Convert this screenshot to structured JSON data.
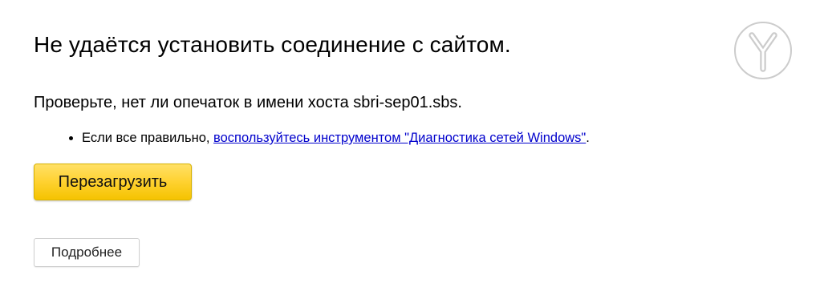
{
  "error": {
    "title": "Не удаётся установить соединение с сайтом.",
    "check_host_text": "Проверьте, нет ли опечаток в имени хоста sbri-sep01.sbs.",
    "hint": {
      "prefix": "Если все правильно, ",
      "link_text": "воспользуйтесь инструментом \"Диагностика сетей Windows\"",
      "suffix": "."
    }
  },
  "buttons": {
    "reload_label": "Перезагрузить",
    "details_label": "Подробнее"
  },
  "icons": {
    "logo": "yandex-browser-logo-icon"
  },
  "colors": {
    "reload_button": "#ffd335",
    "link": "#0000cc",
    "logo_stroke": "#cccccc"
  }
}
